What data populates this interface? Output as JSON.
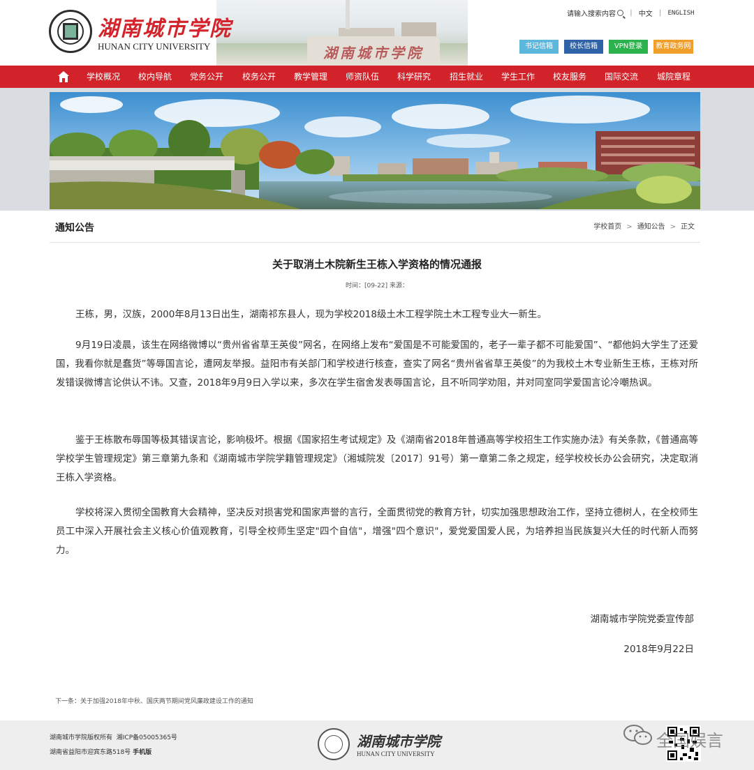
{
  "header": {
    "logo_cn": "湖南城市学院",
    "logo_en": "HUNAN CITY UNIVERSITY",
    "stone_text": "湖南城市学院",
    "search_label": "请输入搜索内容",
    "lang_cn": "中文",
    "lang_en": "ENGLISH",
    "quick_links": [
      {
        "label": "书记信箱",
        "color": "#5bb7dc"
      },
      {
        "label": "校长信箱",
        "color": "#2e63a8"
      },
      {
        "label": "VPN登录",
        "color": "#2bb24c"
      },
      {
        "label": "教育政务网",
        "color": "#f0a02a"
      }
    ]
  },
  "nav": {
    "color": "#d2232a",
    "items": [
      "学校概况",
      "校内导航",
      "党务公开",
      "校务公开",
      "教学管理",
      "师资队伍",
      "科学研究",
      "招生就业",
      "学生工作",
      "校友服务",
      "国际交流",
      "城院章程"
    ]
  },
  "section": {
    "title": "通知公告",
    "breadcrumb": [
      "学校首页",
      "通知公告",
      "正文"
    ]
  },
  "article": {
    "title": "关于取消土木院新生王栋入学资格的情况通报",
    "meta": "时间：[09-22] 来源：",
    "paragraphs": [
      "王栋，男，汉族，2000年8月13日出生，湖南祁东县人，现为学校2018级土木工程学院土木工程专业大一新生。",
      "9月19日凌晨，该生在网络微博以“贵州省省草王英俊”网名，在网络上发布“爱国是不可能爱国的，老子一辈子都不可能爱国”、“都他妈大学生了还爱国，我看你就是蠢货”等辱国言论，遭网友举报。益阳市有关部门和学校进行核查，查实了网名“贵州省省草王英俊”的为我校土木专业新生王栋，王栋对所发错误微博言论供认不讳。又查，2018年9月9日入学以来，多次在学生宿舍发表辱国言论，且不听同学劝阻，并对同室同学爱国言论冷嘲热讽。",
      "鉴于王栋散布辱国等极其错误言论，影响极坏。根据《国家招生考试规定》及《湖南省2018年普通高等学校招生工作实施办法》有关条款，《普通高等学校学生管理规定》第三章第九条和《湖南城市学院学籍管理规定》（湘城院发〔2017〕91号）第一章第二条之规定，经学校校长办公会研究，决定取消王栋入学资格。",
      "学校将深入贯彻全国教育大会精神，坚决反对损害党和国家声誉的言行，全面贯彻党的教育方针，切实加强思想政治工作，坚持立德树人，在全校师生员工中深入开展社会主义核心价值观教育，引导全校师生坚定\"四个自信\"，增强\"四个意识\"，爱党爱国爱人民，为培养担当民族复兴大任的时代新人而努力。"
    ],
    "signature_org": "湖南城市学院党委宣传部",
    "signature_date": "2018年9月22日",
    "next_link": "下一条：关于加强2018年中秋、国庆两节期间党风廉政建设工作的通知"
  },
  "footer": {
    "copyright": "湖南城市学院版权所有",
    "icp": "湘ICP备05005365号",
    "address": "湖南省益阳市迎宾东路518号",
    "mobile": "手机版",
    "logo_cn": "湖南城市学院",
    "logo_en": "HUNAN CITY UNIVERSITY",
    "watermark": "全国娱言"
  }
}
